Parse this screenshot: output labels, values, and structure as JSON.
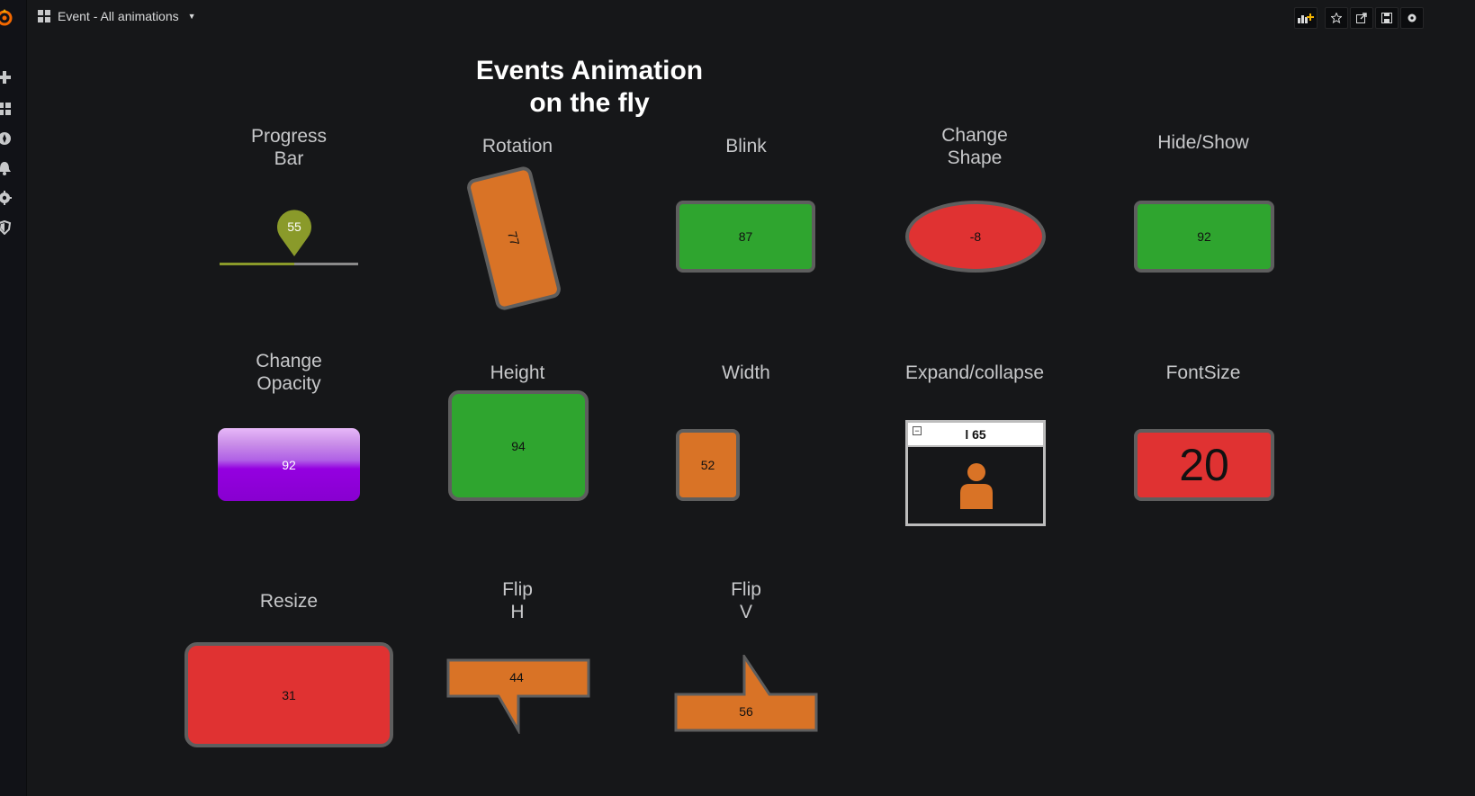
{
  "header": {
    "dashboard_title": "Event - All animations",
    "buttons": [
      "add-panel-icon",
      "star-icon",
      "share-icon",
      "save-icon",
      "settings-icon"
    ]
  },
  "sidebar": {
    "icons": [
      "grafana-logo",
      "plus-icon",
      "dashboards-icon",
      "explore-icon",
      "alert-bell-icon",
      "gear-icon",
      "shield-icon"
    ]
  },
  "title": "Events Animation\non the fly",
  "animations": {
    "progress_bar": {
      "label": "Progress\nBar",
      "value": "55"
    },
    "rotation": {
      "label": "Rotation",
      "value": "77"
    },
    "blink": {
      "label": "Blink",
      "value": "87"
    },
    "change_shape": {
      "label": "Change\nShape",
      "value": "-8"
    },
    "hide_show": {
      "label": "Hide/Show",
      "value": "92"
    },
    "change_opacity": {
      "label": "Change\nOpacity",
      "value": "92"
    },
    "height": {
      "label": "Height",
      "value": "94"
    },
    "width": {
      "label": "Width",
      "value": "52"
    },
    "expand_collapse": {
      "label": "Expand/collapse",
      "value": "l 65"
    },
    "font_size": {
      "label": "FontSize",
      "value": "20"
    },
    "resize": {
      "label": "Resize",
      "value": "31"
    },
    "flip_h": {
      "label": "Flip\nH",
      "value": "44"
    },
    "flip_v": {
      "label": "Flip\nV",
      "value": "56"
    }
  },
  "colors": {
    "green": "#2fa52f",
    "red": "#e03232",
    "orange": "#d97326",
    "purple": "#9400e0",
    "olive": "#8a9a2a",
    "border": "#5e5e5e"
  }
}
